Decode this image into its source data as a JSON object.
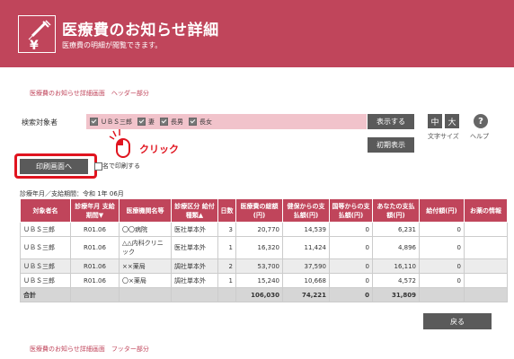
{
  "header": {
    "title": "医療費のお知らせ詳細",
    "subtitle": "医療費の明細が閲覧できます。",
    "icon_glyph": "¥"
  },
  "section_labels": {
    "top": "医療費のお知らせ詳細画面　ヘッダー部分",
    "bottom": "医療費のお知らせ詳細画面　フッター部分"
  },
  "target": {
    "label": "検索対象者",
    "options": [
      "ＵＢＳ三郎",
      "妻",
      "長男",
      "長女"
    ],
    "display_button": "表示する",
    "initial_button": "初期表示"
  },
  "text_size": {
    "medium": "中",
    "large": "大",
    "label": "文字サイズ"
  },
  "help": {
    "glyph": "?",
    "label": "ヘルプ"
  },
  "print": {
    "button": "印刷画面へ",
    "checkbox_label": "名で印刷する",
    "annotation": "クリック"
  },
  "period": "診療年月／支給期間：令和 1年 06月",
  "table": {
    "headers": [
      "対象者名",
      "診療年月 支給期間▼",
      "医療機関名等",
      "診療区分 給付種類▲",
      "日数",
      "医療費の総額(円)",
      "健保からの支払額(円)",
      "国等からの支払額(円)",
      "あなたの支払額(円)",
      "給付額(円)",
      "お薬の情報"
    ],
    "rows": [
      [
        "ＵＢＳ三郎",
        "R01.06",
        "〇〇病院",
        "医社単本外",
        "3",
        "20,770",
        "14,539",
        "0",
        "6,231",
        "0",
        ""
      ],
      [
        "ＵＢＳ三郎",
        "R01.06",
        "△△内科クリニック",
        "医社単本外",
        "1",
        "16,320",
        "11,424",
        "0",
        "4,896",
        "0",
        ""
      ],
      [
        "ＵＢＳ三郎",
        "R01.06",
        "××薬局",
        "調社単本外",
        "2",
        "53,700",
        "37,590",
        "0",
        "16,110",
        "0",
        ""
      ],
      [
        "ＵＢＳ三郎",
        "R01.06",
        "〇×薬局",
        "調社単本外",
        "1",
        "15,240",
        "10,668",
        "0",
        "4,572",
        "0",
        ""
      ]
    ],
    "total": [
      "合計",
      "",
      "",
      "",
      "",
      "106,030",
      "74,221",
      "0",
      "31,809",
      "",
      ""
    ]
  },
  "back_button": "戻る",
  "colors": {
    "brand": "#c0455b",
    "annotation": "#e0141f",
    "target_bar": "#f1c3cb"
  }
}
